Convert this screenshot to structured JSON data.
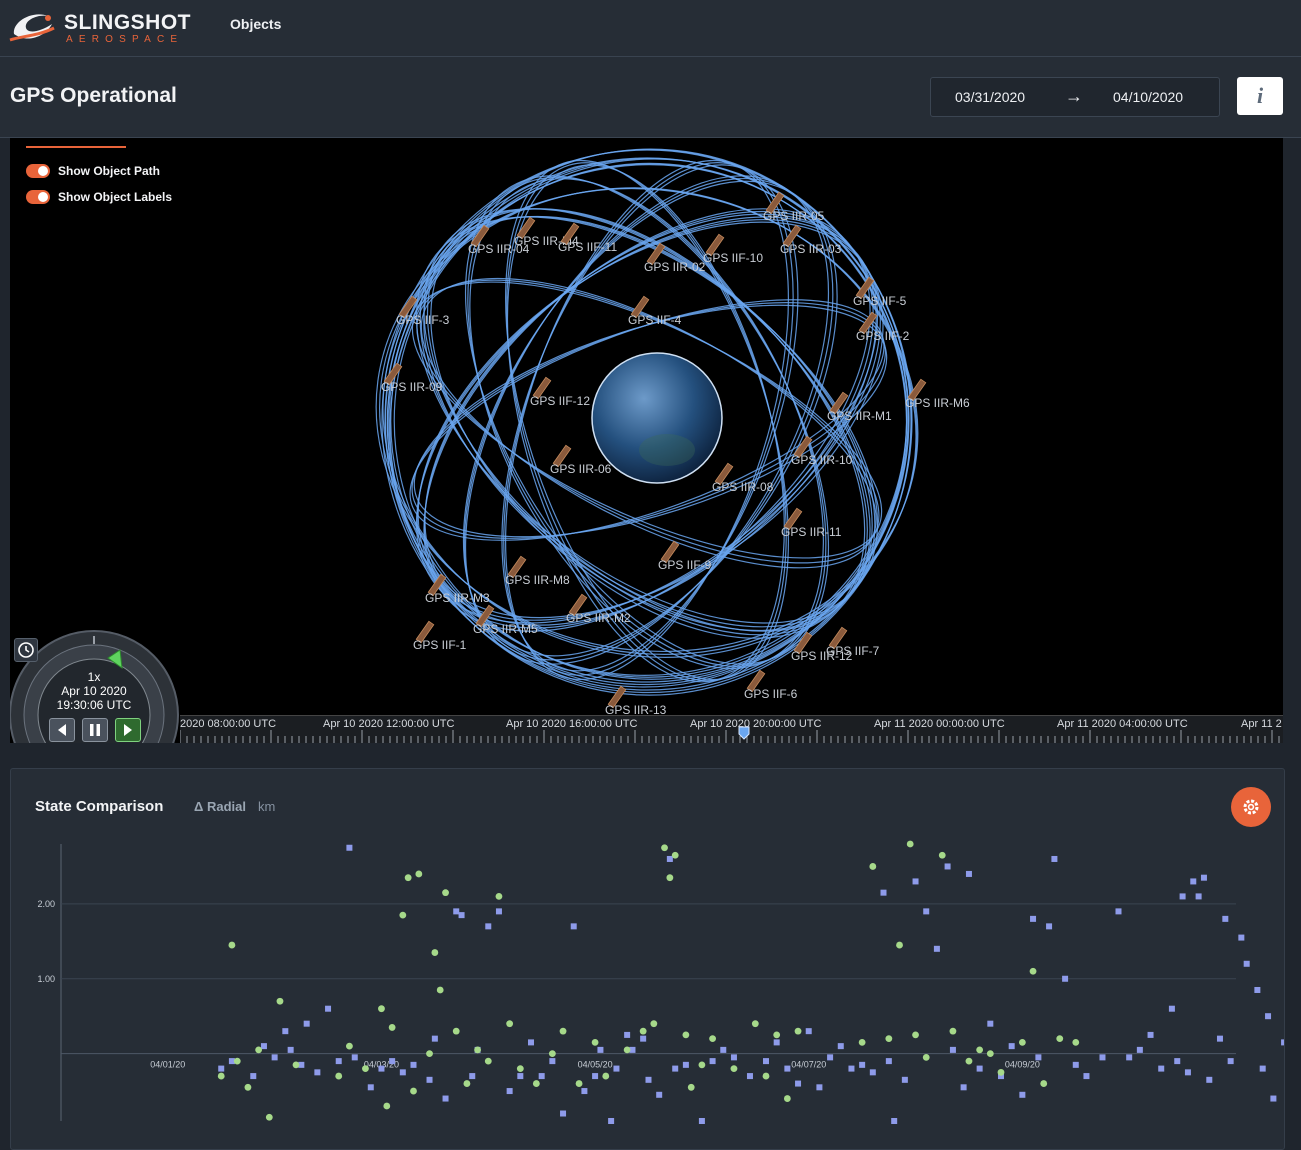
{
  "brand": {
    "name": "SLINGSHOT",
    "tagline": "AEROSPACE",
    "accent": "#e8643a"
  },
  "nav": {
    "objects_label": "Objects"
  },
  "header": {
    "title": "GPS Operational",
    "date_start": "03/31/2020",
    "date_arrow": "→",
    "date_end": "04/10/2020",
    "info_label": "i"
  },
  "viewer": {
    "toggles": [
      {
        "label": "Show Object Path",
        "on": true
      },
      {
        "label": "Show Object Labels",
        "on": true
      }
    ],
    "orbit_color": "#6aa6f0",
    "satellites": [
      "GPS IIR-04",
      "GPS IIR-M4",
      "GPS IIF-11",
      "GPS IIR-05",
      "GPS IIF-10",
      "GPS IIR-03",
      "GPS IIR-02",
      "GPS IIF-3",
      "GPS IIF-4",
      "GPS IIF-5",
      "GPS IIF-2",
      "GPS IIR-09",
      "GPS IIF-12",
      "GPS IIR-M6",
      "GPS IIR-M1",
      "GPS IIR-06",
      "GPS IIR-08",
      "GPS IIR-10",
      "GPS IIR-11",
      "GPS IIF-9",
      "GPS IIR-M8",
      "GPS IIR-M3",
      "GPS IIR-M2",
      "GPS IIR-M5",
      "GPS IIF-1",
      "GPS IIF-7",
      "GPS IIR-12",
      "GPS IIF-6",
      "GPS IIR-13"
    ],
    "animation": {
      "speed": "1x",
      "date": "Apr 10 2020",
      "time": "19:30:06 UTC"
    },
    "timeline_labels": [
      "2020 08:00:00 UTC",
      "Apr 10 2020 12:00:00 UTC",
      "Apr 10 2020 16:00:00 UTC",
      "Apr 10 2020 20:00:00 UTC",
      "Apr 11 2020 00:00:00 UTC",
      "Apr 11 2020 04:00:00 UTC",
      "Apr 11 2"
    ]
  },
  "state_comparison": {
    "title": "State Comparison",
    "metric": "Δ Radial",
    "unit": "km",
    "colors": {
      "series_a": "#8e9bea",
      "series_b": "#a6d98a"
    }
  },
  "chart_data": {
    "type": "scatter",
    "title": "State Comparison",
    "ylabel": "Δ Radial km",
    "x_tick_labels": [
      "04/01/20",
      "04/03/20",
      "04/05/20",
      "04/07/20",
      "04/09/20"
    ],
    "y_tick_labels": [
      "1.00",
      "2.00"
    ],
    "ylim": [
      -0.9,
      2.8
    ],
    "xlim": [
      0,
      11
    ],
    "grid": true,
    "series": [
      {
        "marker": "square",
        "points": [
          [
            1.5,
            -0.2
          ],
          [
            1.6,
            -0.1
          ],
          [
            1.8,
            -0.3
          ],
          [
            1.9,
            0.1
          ],
          [
            2.0,
            -0.05
          ],
          [
            2.1,
            0.3
          ],
          [
            2.15,
            0.05
          ],
          [
            2.25,
            -0.15
          ],
          [
            2.3,
            0.4
          ],
          [
            2.4,
            -0.25
          ],
          [
            2.5,
            0.6
          ],
          [
            2.6,
            -0.1
          ],
          [
            2.7,
            2.75
          ],
          [
            2.75,
            -0.05
          ],
          [
            2.9,
            -0.45
          ],
          [
            3.0,
            -0.2
          ],
          [
            3.1,
            -0.1
          ],
          [
            3.2,
            -0.25
          ],
          [
            3.3,
            -0.15
          ],
          [
            3.45,
            -0.35
          ],
          [
            3.5,
            0.2
          ],
          [
            3.6,
            -0.6
          ],
          [
            3.7,
            1.9
          ],
          [
            3.75,
            1.85
          ],
          [
            3.85,
            -0.3
          ],
          [
            3.9,
            0.05
          ],
          [
            4.0,
            1.7
          ],
          [
            4.1,
            1.9
          ],
          [
            4.2,
            -0.5
          ],
          [
            4.3,
            -0.3
          ],
          [
            4.4,
            0.15
          ],
          [
            4.5,
            -0.3
          ],
          [
            4.6,
            -0.1
          ],
          [
            4.7,
            -0.8
          ],
          [
            4.8,
            1.7
          ],
          [
            4.9,
            -0.5
          ],
          [
            5.0,
            -0.3
          ],
          [
            5.05,
            0.05
          ],
          [
            5.15,
            -0.9
          ],
          [
            5.2,
            -0.2
          ],
          [
            5.3,
            0.25
          ],
          [
            5.35,
            0.05
          ],
          [
            5.45,
            0.2
          ],
          [
            5.5,
            -0.35
          ],
          [
            5.6,
            -0.55
          ],
          [
            5.7,
            2.6
          ],
          [
            5.75,
            -0.2
          ],
          [
            5.85,
            -0.15
          ],
          [
            6.0,
            -0.9
          ],
          [
            6.1,
            -0.1
          ],
          [
            6.2,
            0.05
          ],
          [
            6.3,
            -0.05
          ],
          [
            6.45,
            -0.3
          ],
          [
            6.6,
            -0.1
          ],
          [
            6.7,
            0.15
          ],
          [
            6.8,
            -0.2
          ],
          [
            6.9,
            -0.4
          ],
          [
            7.0,
            0.3
          ],
          [
            7.1,
            -0.45
          ],
          [
            7.2,
            -0.05
          ],
          [
            7.3,
            0.1
          ],
          [
            7.4,
            -0.2
          ],
          [
            7.5,
            -0.15
          ],
          [
            7.6,
            -0.25
          ],
          [
            7.7,
            2.15
          ],
          [
            7.75,
            -0.1
          ],
          [
            7.8,
            -0.9
          ],
          [
            7.9,
            -0.35
          ],
          [
            8.0,
            2.3
          ],
          [
            8.1,
            1.9
          ],
          [
            8.2,
            1.4
          ],
          [
            8.3,
            2.5
          ],
          [
            8.35,
            0.05
          ],
          [
            8.45,
            -0.45
          ],
          [
            8.5,
            2.4
          ],
          [
            8.6,
            -0.2
          ],
          [
            8.7,
            0.4
          ],
          [
            8.8,
            -0.3
          ],
          [
            8.9,
            0.1
          ],
          [
            9.0,
            -0.55
          ],
          [
            9.1,
            1.8
          ],
          [
            9.15,
            -0.05
          ],
          [
            9.25,
            1.7
          ],
          [
            9.3,
            2.6
          ],
          [
            9.4,
            1.0
          ],
          [
            9.5,
            -0.15
          ],
          [
            9.6,
            -0.3
          ],
          [
            9.75,
            -0.05
          ],
          [
            9.9,
            1.9
          ],
          [
            10.0,
            -0.05
          ],
          [
            10.1,
            0.05
          ],
          [
            10.2,
            0.25
          ],
          [
            10.3,
            -0.2
          ],
          [
            10.4,
            0.6
          ],
          [
            10.45,
            -0.1
          ],
          [
            10.5,
            2.1
          ],
          [
            10.55,
            -0.25
          ],
          [
            10.6,
            2.3
          ],
          [
            10.65,
            2.1
          ],
          [
            10.7,
            2.35
          ],
          [
            10.75,
            -0.35
          ],
          [
            10.85,
            0.2
          ],
          [
            10.9,
            1.8
          ],
          [
            10.95,
            -0.1
          ],
          [
            11.05,
            1.55
          ],
          [
            11.1,
            1.2
          ],
          [
            11.2,
            0.85
          ],
          [
            11.25,
            -0.2
          ],
          [
            11.3,
            0.5
          ],
          [
            11.35,
            -0.6
          ],
          [
            11.45,
            0.15
          ],
          [
            11.5,
            -0.35
          ],
          [
            11.6,
            -0.05
          ],
          [
            11.65,
            -0.8
          ],
          [
            11.7,
            2.05
          ],
          [
            11.8,
            -0.4
          ]
        ]
      },
      {
        "marker": "circle",
        "points": [
          [
            1.5,
            -0.3
          ],
          [
            1.6,
            1.45
          ],
          [
            1.65,
            -0.1
          ],
          [
            1.75,
            -0.45
          ],
          [
            1.85,
            0.05
          ],
          [
            1.95,
            -0.85
          ],
          [
            2.05,
            0.7
          ],
          [
            2.2,
            -0.15
          ],
          [
            2.6,
            -0.3
          ],
          [
            2.7,
            0.1
          ],
          [
            2.85,
            -0.2
          ],
          [
            3.0,
            0.6
          ],
          [
            3.05,
            -0.7
          ],
          [
            3.1,
            0.35
          ],
          [
            3.2,
            1.85
          ],
          [
            3.25,
            2.35
          ],
          [
            3.3,
            -0.5
          ],
          [
            3.35,
            2.4
          ],
          [
            3.45,
            0.0
          ],
          [
            3.5,
            1.35
          ],
          [
            3.55,
            0.85
          ],
          [
            3.6,
            2.15
          ],
          [
            3.7,
            0.3
          ],
          [
            3.8,
            -0.4
          ],
          [
            3.9,
            0.05
          ],
          [
            4.0,
            -0.1
          ],
          [
            4.1,
            2.1
          ],
          [
            4.2,
            0.4
          ],
          [
            4.3,
            -0.2
          ],
          [
            4.45,
            -0.4
          ],
          [
            4.6,
            0.0
          ],
          [
            4.7,
            0.3
          ],
          [
            4.85,
            -0.4
          ],
          [
            5.0,
            0.15
          ],
          [
            5.1,
            -0.3
          ],
          [
            5.3,
            0.05
          ],
          [
            5.45,
            0.3
          ],
          [
            5.55,
            0.4
          ],
          [
            5.65,
            2.75
          ],
          [
            5.7,
            2.35
          ],
          [
            5.75,
            2.65
          ],
          [
            5.85,
            0.25
          ],
          [
            5.9,
            -0.45
          ],
          [
            6.0,
            -0.15
          ],
          [
            6.1,
            0.2
          ],
          [
            6.3,
            -0.2
          ],
          [
            6.5,
            0.4
          ],
          [
            6.6,
            -0.3
          ],
          [
            6.7,
            0.25
          ],
          [
            6.8,
            -0.6
          ],
          [
            6.9,
            0.3
          ],
          [
            7.5,
            0.15
          ],
          [
            7.6,
            2.5
          ],
          [
            7.75,
            0.2
          ],
          [
            7.85,
            1.45
          ],
          [
            7.95,
            2.8
          ],
          [
            8.0,
            0.25
          ],
          [
            8.1,
            -0.05
          ],
          [
            8.25,
            2.65
          ],
          [
            8.35,
            0.3
          ],
          [
            8.5,
            -0.1
          ],
          [
            8.6,
            0.05
          ],
          [
            8.7,
            0.0
          ],
          [
            8.8,
            -0.25
          ],
          [
            9.0,
            0.15
          ],
          [
            9.1,
            1.1
          ],
          [
            9.2,
            -0.4
          ],
          [
            9.35,
            0.2
          ],
          [
            9.5,
            0.15
          ]
        ]
      }
    ]
  }
}
